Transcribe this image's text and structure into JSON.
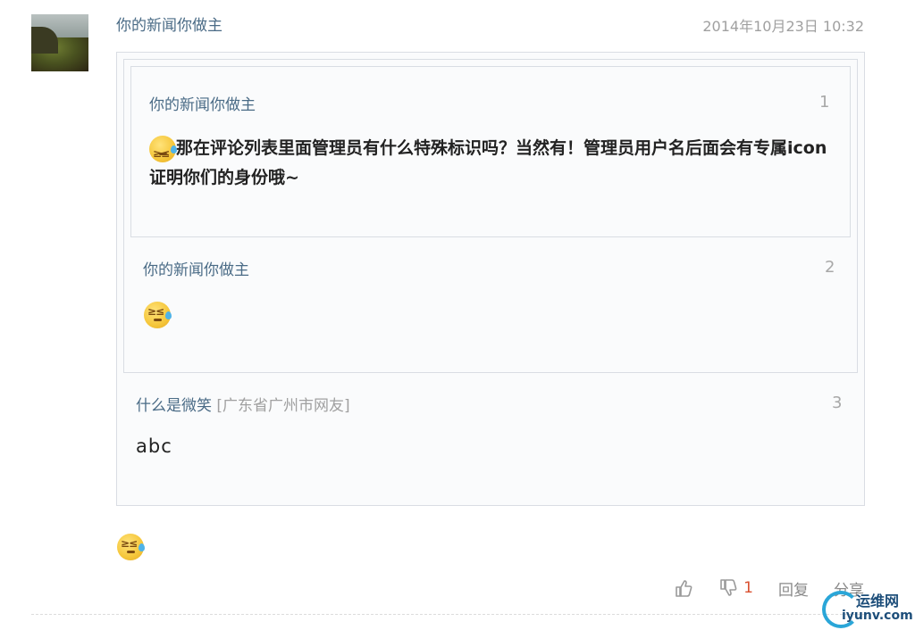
{
  "post": {
    "username": "你的新闻你做主",
    "timestamp": "2014年10月23日 10:32",
    "body_emoji": "grimace-sweat-emoji"
  },
  "quotes": [
    {
      "number": "1",
      "username": "你的新闻你做主",
      "text": "那在评论列表里面管理员有什么特殊标识吗？当然有！管理员用户名后面会有专属icon证明你们的身份哦~"
    },
    {
      "number": "2",
      "username": "你的新闻你做主",
      "text": ""
    },
    {
      "number": "3",
      "username": "什么是微笑",
      "location": "[广东省广州市网友]",
      "text": "abc"
    }
  ],
  "actions": {
    "like_icon": "thumbs-up-icon",
    "dislike_icon": "thumbs-down-icon",
    "dislike_count": "1",
    "reply_label": "回复",
    "share_label": "分享"
  },
  "watermark": {
    "title": "运维网",
    "domain": "iyunv.com"
  },
  "colors": {
    "username": "#4a6b86",
    "count": "#d9502f",
    "muted": "#a0a0a0"
  }
}
